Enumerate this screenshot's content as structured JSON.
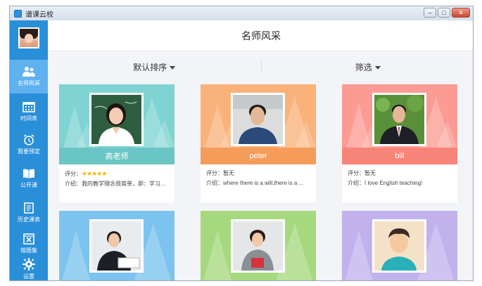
{
  "window": {
    "title": "谱课云校"
  },
  "sidebar": {
    "items": [
      {
        "label": "名师风采",
        "icon": "teachers-icon",
        "active": true
      },
      {
        "label": "时间表",
        "icon": "calendar-icon"
      },
      {
        "label": "我要预定",
        "icon": "alarm-clock-icon"
      },
      {
        "label": "公开课",
        "icon": "book-icon"
      },
      {
        "label": "历史课表",
        "icon": "history-doc-icon"
      },
      {
        "label": "错题集",
        "icon": "wrong-questions-icon"
      },
      {
        "label": "设置",
        "icon": "gear-icon"
      }
    ]
  },
  "header": {
    "title": "名师风采"
  },
  "toolbar": {
    "sort_label": "默认排序",
    "filter_label": "筛选"
  },
  "cards": [
    {
      "name": "高老师",
      "rating_label": "评分：",
      "rating": "★★★★★",
      "intro_label": "介绍：",
      "intro": "我的教学理念很简单，即：学习...",
      "color": "#7fd3d2",
      "bar": "#6ac6c4"
    },
    {
      "name": "peter",
      "rating_label": "评分：",
      "rating": "暂无",
      "intro_label": "介绍：",
      "intro": "where there is a will,there is a ...",
      "color": "#f9b27a",
      "bar": "#f59c5a"
    },
    {
      "name": "bill",
      "rating_label": "评分：",
      "rating": "暂无",
      "intro_label": "介绍：",
      "intro": "I love English teaching!",
      "color": "#fc9b93",
      "bar": "#f88479"
    },
    {
      "name": "",
      "color": "#7cc3ef"
    },
    {
      "name": "",
      "color": "#a6d97e"
    },
    {
      "name": "",
      "color": "#c1b2ee"
    }
  ]
}
